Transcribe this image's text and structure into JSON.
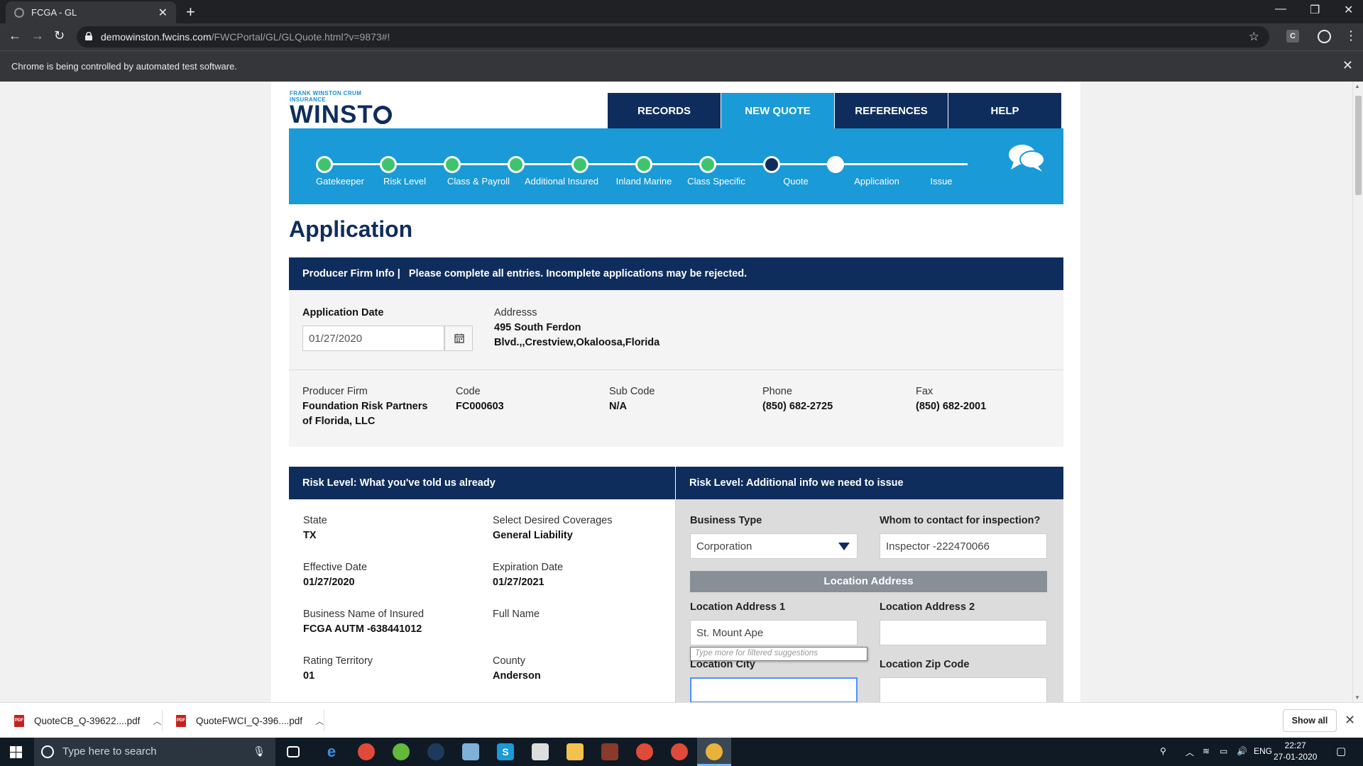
{
  "browser": {
    "tab_title": "FCGA - GL",
    "url_host": "demowinston.fwcins.com",
    "url_path": "/FWCPortal/GL/GLQuote.html?v=9873#!",
    "ext_label": "C",
    "infobar": "Chrome is being controlled by automated test software."
  },
  "header": {
    "logo_small": "FRANK WINSTON CRUM INSURANCE",
    "logo_big_1": "WINST",
    "logo_big_2": "N",
    "nav": [
      {
        "label": "RECORDS",
        "active": false
      },
      {
        "label": "NEW QUOTE",
        "active": true
      },
      {
        "label": "REFERENCES",
        "active": false
      },
      {
        "label": "HELP",
        "active": false
      }
    ]
  },
  "stepper": {
    "steps": [
      {
        "label": "Gatekeeper",
        "state": "done"
      },
      {
        "label": "Risk Level",
        "state": "done"
      },
      {
        "label": "Class & Payroll",
        "state": "done"
      },
      {
        "label": "Additional Insured",
        "state": "done"
      },
      {
        "label": "Inland Marine",
        "state": "done"
      },
      {
        "label": "Class Specific",
        "state": "done"
      },
      {
        "label": "Quote",
        "state": "done"
      },
      {
        "label": "Application",
        "state": "current"
      },
      {
        "label": "Issue",
        "state": "todo"
      }
    ]
  },
  "page_title": "Application",
  "producer_section": {
    "header_prefix": "Producer Firm Info |",
    "header_text": "Please complete all entries. Incomplete applications may be rejected.",
    "application_date_label": "Application Date",
    "application_date_value": "01/27/2020",
    "address_label": "Addresss",
    "address_line1": "495 South Ferdon",
    "address_line2": "Blvd.,,Crestview,Okaloosa,Florida",
    "producer_firm_label": "Producer Firm",
    "producer_firm_line1": "Foundation Risk Partners",
    "producer_firm_line2": "of Florida, LLC",
    "code_label": "Code",
    "code_value": "FC000603",
    "sub_code_label": "Sub Code",
    "sub_code_value": "N/A",
    "phone_label": "Phone",
    "phone_value": "(850) 682-2725",
    "fax_label": "Fax",
    "fax_value": "(850) 682-2001"
  },
  "risk_left": {
    "header": "Risk Level: What you've told us already",
    "state_label": "State",
    "state_value": "TX",
    "coverages_label": "Select Desired Coverages",
    "coverages_value": "General Liability",
    "effective_label": "Effective Date",
    "effective_value": "01/27/2020",
    "expiration_label": "Expiration Date",
    "expiration_value": "01/27/2021",
    "business_name_label": "Business Name of Insured",
    "business_name_value": "FCGA AUTM -638441012",
    "full_name_label": "Full Name",
    "rating_label": "Rating Territory",
    "rating_value": "01",
    "county_label": "County",
    "county_value": "Anderson"
  },
  "risk_right": {
    "header": "Risk Level: Additional info we need to issue",
    "business_type_label": "Business Type",
    "business_type_value": "Corporation",
    "inspection_label": "Whom to contact for inspection?",
    "inspection_value": "Inspector -222470066",
    "location_bar": "Location Address",
    "loc_addr1_label": "Location Address 1",
    "loc_addr1_value": "St. Mount Ape",
    "loc_addr2_label": "Location Address 2",
    "loc_addr2_value": "",
    "suggestion_hint": "Type more for filtered suggestions",
    "loc_city_label": "Location City",
    "loc_city_value": "",
    "loc_zip_label": "Location Zip Code",
    "loc_zip_value": ""
  },
  "downloads": {
    "items": [
      "QuoteCB_Q-39622....pdf",
      "QuoteFWCI_Q-396....pdf"
    ],
    "show_all": "Show all"
  },
  "taskbar": {
    "search_placeholder": "Type here to search",
    "lang": "ENG",
    "time": "22:27",
    "date": "27-01-2020"
  },
  "colors": {
    "navy": "#0f2d5c",
    "accent_blue": "#1a9ad6",
    "step_done": "#3ec46d"
  }
}
